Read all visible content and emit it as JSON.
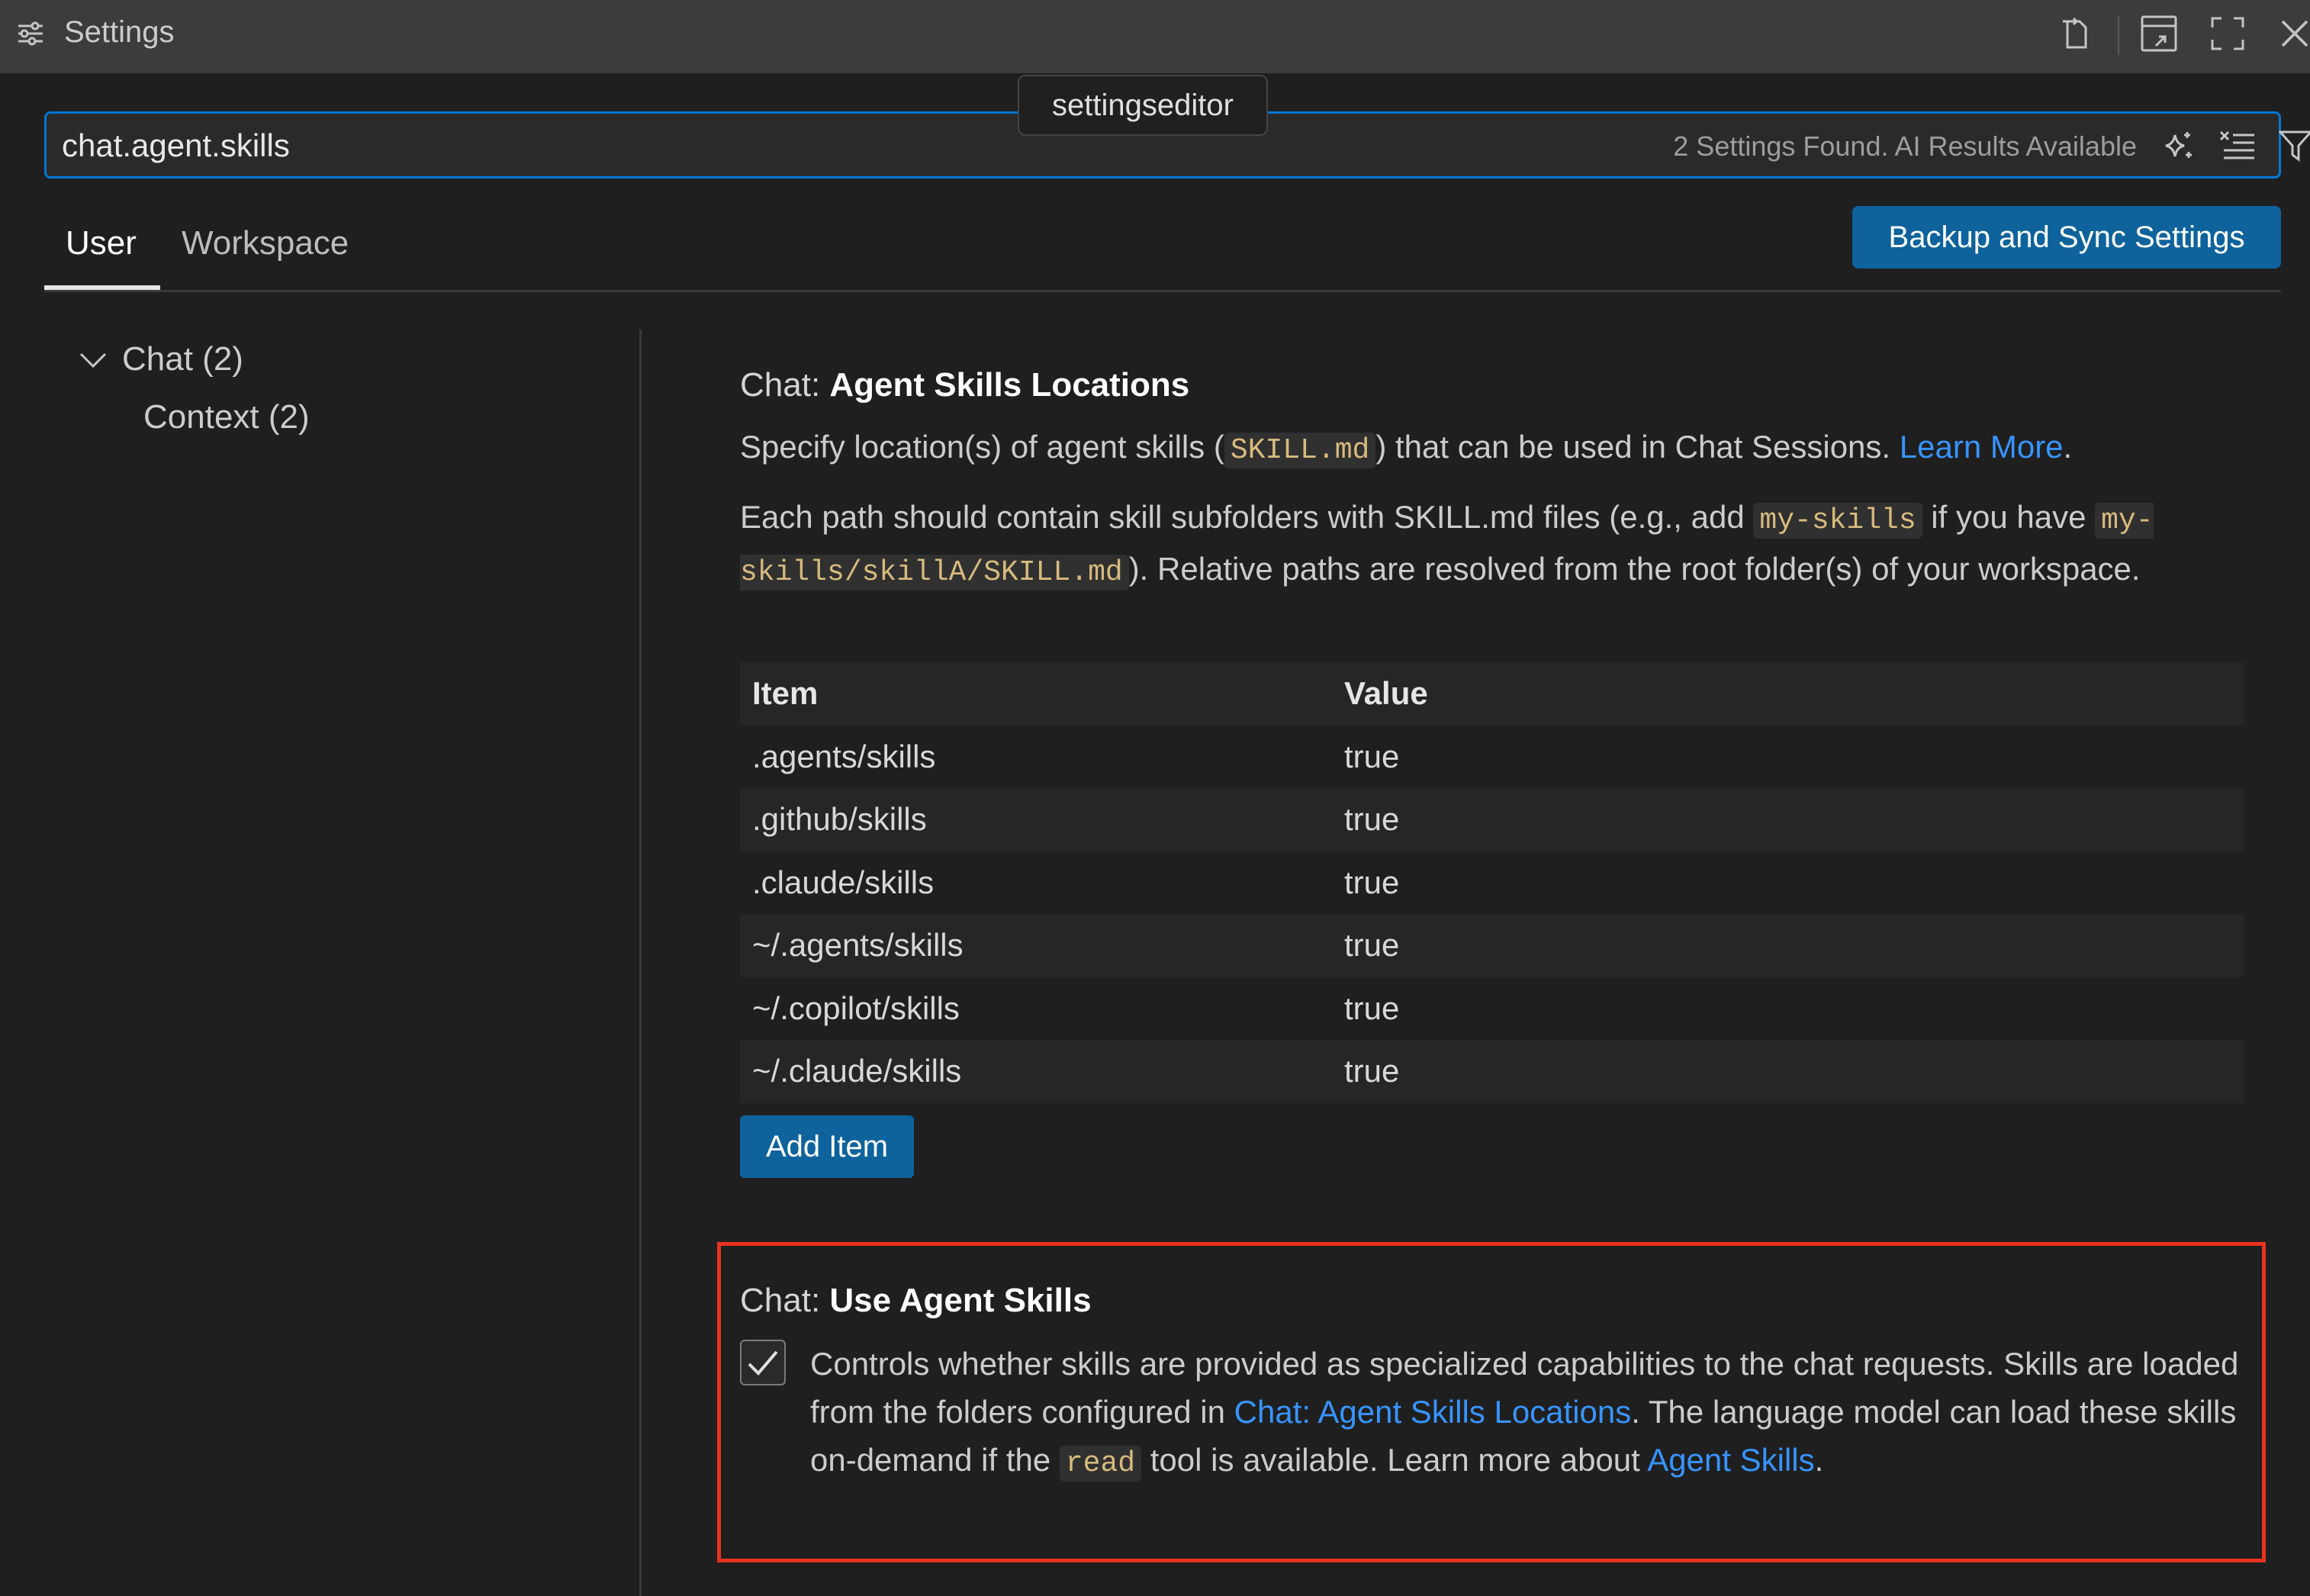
{
  "window": {
    "title": "Settings",
    "actions": [
      "open-settings-json-icon",
      "move-panel-icon",
      "maximize-icon",
      "close-icon"
    ]
  },
  "tooltip": "settingseditor",
  "search": {
    "value": "chat.agent.skills",
    "placeholder": "",
    "result_text": "2 Settings Found. AI Results Available",
    "icons": [
      "ai-sparkle-icon",
      "clear-filter-icon",
      "filter-icon"
    ]
  },
  "tabs": [
    {
      "label": "User",
      "active": true
    },
    {
      "label": "Workspace",
      "active": false
    }
  ],
  "sync_button": "Backup and Sync Settings",
  "toc": [
    {
      "label": "Chat (2)",
      "expanded": true
    },
    {
      "label": "Context (2)"
    }
  ],
  "setting1": {
    "category": "Chat: ",
    "name": "Agent Skills Locations",
    "desc_pre": "Specify location(s) of agent skills (",
    "desc_code": "SKILL.md",
    "desc_mid": ") that can be used in Chat Sessions. ",
    "desc_link": "Learn More",
    "desc_end": ".",
    "desc2_a": "Each path should contain skill subfolders with SKILL.md files (e.g., add ",
    "desc2_code1": "my-skills",
    "desc2_b": " if you have ",
    "desc2_code2": "my-skills/skillA/SKILL.md",
    "desc2_c": "). Relative paths are resolved from the root folder(s) of your workspace.",
    "table_headers": [
      "Item",
      "Value"
    ],
    "rows": [
      {
        "item": ".agents/skills",
        "value": "true"
      },
      {
        "item": ".github/skills",
        "value": "true"
      },
      {
        "item": ".claude/skills",
        "value": "true"
      },
      {
        "item": "~/.agents/skills",
        "value": "true"
      },
      {
        "item": "~/.copilot/skills",
        "value": "true"
      },
      {
        "item": "~/.claude/skills",
        "value": "true"
      }
    ],
    "add_button": "Add Item"
  },
  "setting2": {
    "category": "Chat: ",
    "name": "Use Agent Skills",
    "checked": true,
    "desc_a": "Controls whether skills are provided as specialized capabilities to the chat requests. Skills are loaded from the folders configured in ",
    "desc_link1": "Chat: Agent Skills Locations",
    "desc_b": ". The language model can load these skills on-demand if the ",
    "desc_code": "read",
    "desc_c": " tool is available. Learn more about ",
    "desc_link2": "Agent Skills",
    "desc_d": "."
  },
  "colors": {
    "accent": "#0078d4",
    "button": "#0e639c",
    "link": "#3794ff",
    "highlight_border": "#e8331f"
  }
}
